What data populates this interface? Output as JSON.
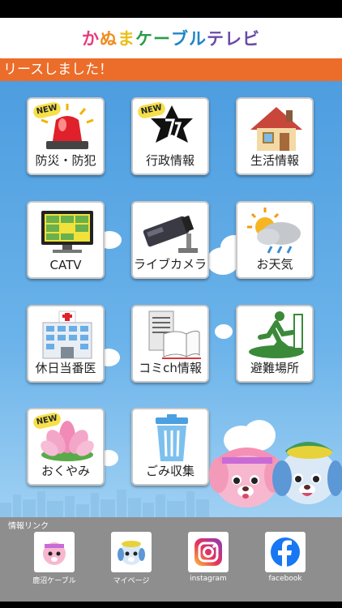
{
  "header": {
    "logo_chars": [
      {
        "t": "か",
        "c": "#e83c7a"
      },
      {
        "t": "ぬ",
        "c": "#f08c1e"
      },
      {
        "t": "ま",
        "c": "#e8c01a"
      },
      {
        "t": "ケ",
        "c": "#2b9c4a"
      },
      {
        "t": "ー",
        "c": "#2b9c4a"
      },
      {
        "t": "ブ",
        "c": "#1f84c8"
      },
      {
        "t": "ル",
        "c": "#1f84c8"
      },
      {
        "t": "テ",
        "c": "#6a4aa8"
      },
      {
        "t": "レ",
        "c": "#6a4aa8"
      },
      {
        "t": "ビ",
        "c": "#6a4aa8"
      }
    ]
  },
  "ticker": {
    "text": "リースしました！"
  },
  "tiles": [
    {
      "label": "防災・防犯",
      "icon": "siren-icon",
      "new": true
    },
    {
      "label": "行政情報",
      "icon": "city-emblem-icon",
      "new": true
    },
    {
      "label": "生活情報",
      "icon": "house-icon",
      "new": false
    },
    {
      "label": "CATV",
      "icon": "tv-icon",
      "new": false
    },
    {
      "label": "ライブカメラ",
      "icon": "camera-icon",
      "new": false
    },
    {
      "label": "お天気",
      "icon": "weather-icon",
      "new": false
    },
    {
      "label": "休日当番医",
      "icon": "hospital-icon",
      "new": false
    },
    {
      "label": "コミch情報",
      "icon": "newspaper-icon",
      "new": false
    },
    {
      "label": "避難場所",
      "icon": "evacuation-icon",
      "new": false
    },
    {
      "label": "おくやみ",
      "icon": "lotus-icon",
      "new": true
    },
    {
      "label": "ごみ収集",
      "icon": "trash-can-icon",
      "new": false
    }
  ],
  "badge": {
    "new_text": "NEW"
  },
  "footer": {
    "title": "情報リンク",
    "links": [
      {
        "label": "鹿沼ケーブル",
        "icon": "mascot-pink-icon"
      },
      {
        "label": "マイページ",
        "icon": "mascot-blue-icon"
      },
      {
        "label": "instagram",
        "icon": "instagram-icon"
      },
      {
        "label": "facebook",
        "icon": "facebook-icon"
      }
    ]
  },
  "colors": {
    "accent": "#ec6c2a",
    "sky": "#4d9de0",
    "footer": "#8e8e8e",
    "facebook": "#1877f2"
  }
}
